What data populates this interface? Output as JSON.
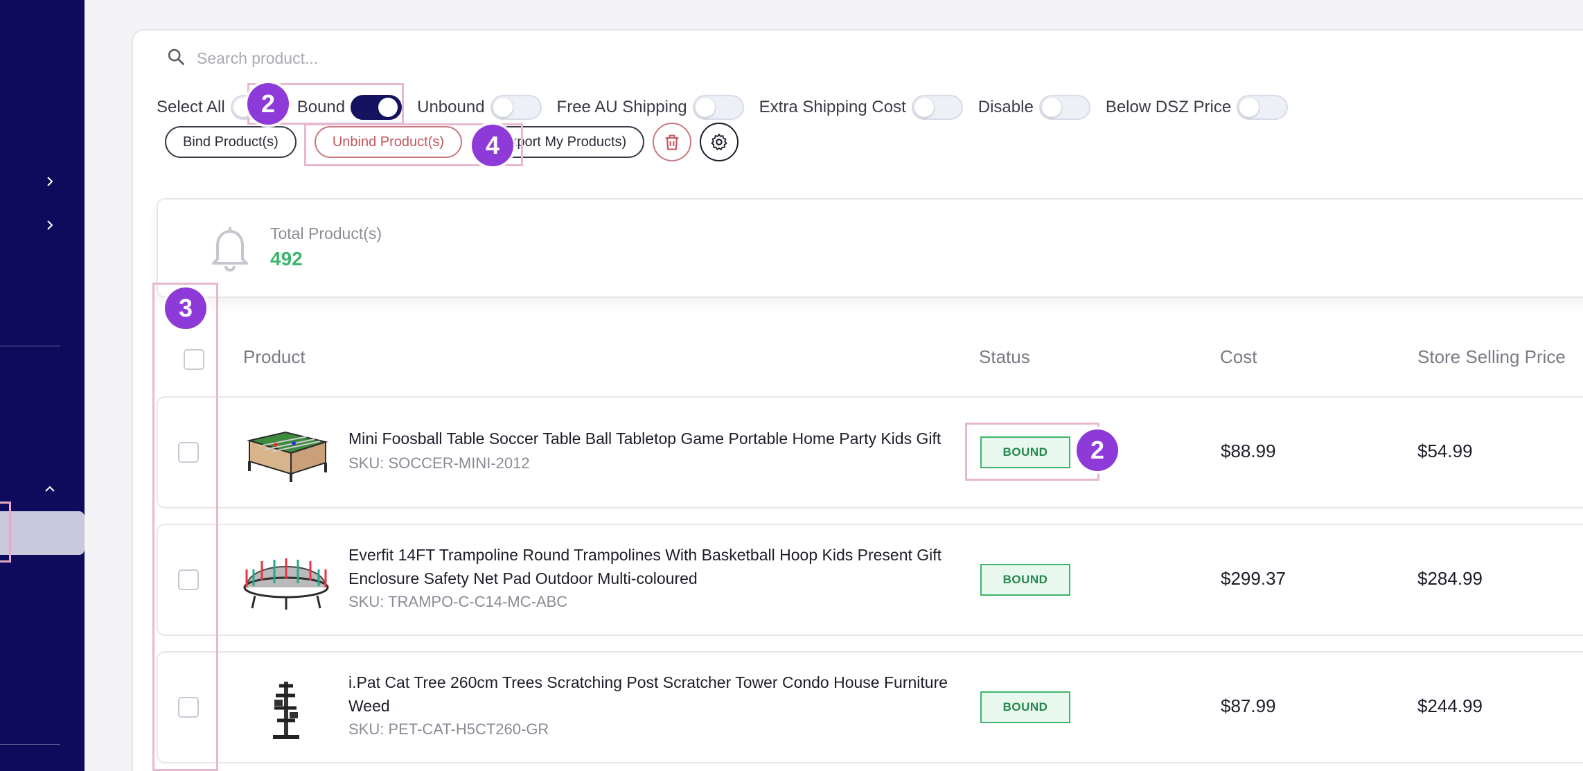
{
  "search": {
    "placeholder": "Search product..."
  },
  "filters": [
    {
      "label": "Select All",
      "on": false
    },
    {
      "label": "Bound",
      "on": true
    },
    {
      "label": "Unbound",
      "on": false
    },
    {
      "label": "Free AU Shipping",
      "on": false
    },
    {
      "label": "Extra Shipping Cost",
      "on": false
    },
    {
      "label": "Disable",
      "on": false
    },
    {
      "label": "Below DSZ Price",
      "on": false
    }
  ],
  "actions": {
    "bind": "Bind Product(s)",
    "unbind": "Unbind Product(s)",
    "export": "Export My Products)"
  },
  "summary": {
    "title": "Total Product(s)",
    "value": "492"
  },
  "table": {
    "headers": {
      "product": "Product",
      "status": "Status",
      "cost": "Cost",
      "price": "Store Selling Price"
    },
    "rows": [
      {
        "title": "Mini Foosball Table Soccer Table Ball Tabletop Game Portable Home Party Kids Gift",
        "sku": "SKU: SOCCER-MINI-2012",
        "status": "BOUND",
        "cost": "$88.99",
        "price": "$54.99",
        "image": "foosball-table-icon"
      },
      {
        "title": "Everfit 14FT Trampoline Round Trampolines With Basketball Hoop Kids Present Gift Enclosure Safety Net Pad Outdoor Multi-coloured",
        "sku": "SKU: TRAMPO-C-C14-MC-ABC",
        "status": "BOUND",
        "cost": "$299.37",
        "price": "$284.99",
        "image": "trampoline-icon"
      },
      {
        "title": "i.Pat Cat Tree 260cm Trees Scratching Post Scratcher Tower Condo House Furniture Weed",
        "sku": "SKU: PET-CAT-H5CT260-GR",
        "status": "BOUND",
        "cost": "$87.99",
        "price": "$244.99",
        "image": "cat-tree-icon"
      }
    ]
  },
  "markers": {
    "bound_toggle": "2",
    "unbind": "4",
    "checkbox_column": "3",
    "status_badge": "2"
  },
  "colors": {
    "sidebar": "#0f0b5c",
    "toggle_on": "#15135f",
    "badge_green": "#3fb56b",
    "marker": "#8d3ad8",
    "highlight": "#e7b9cf"
  }
}
